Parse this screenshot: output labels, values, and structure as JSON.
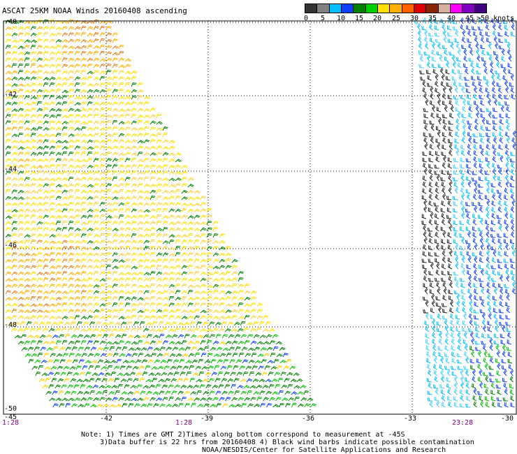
{
  "header": {
    "title": "ASCAT 25KM NOAA Winds 20160408 ascending"
  },
  "legend": {
    "swatches": [
      {
        "color": "#333333"
      },
      {
        "color": "#808080"
      },
      {
        "color": "#00bfff"
      },
      {
        "color": "#1040ff"
      },
      {
        "color": "#008000"
      },
      {
        "color": "#00d000"
      },
      {
        "color": "#ffe000"
      },
      {
        "color": "#ffb000"
      },
      {
        "color": "#ff6000"
      },
      {
        "color": "#e00000"
      },
      {
        "color": "#8b2500"
      },
      {
        "color": "#d8b0a0"
      },
      {
        "color": "#ff00ff"
      },
      {
        "color": "#8000c0"
      },
      {
        "color": "#400080"
      }
    ],
    "labels": [
      "0",
      "5",
      "10",
      "15",
      "20",
      "25",
      "30",
      "35",
      "40",
      "45",
      ">50 knots"
    ]
  },
  "map": {
    "lon_ticks": [
      "-45",
      "-42",
      "-39",
      "-36",
      "-33",
      "-30"
    ],
    "lat_ticks": [
      "-40",
      "-42",
      "-44",
      "-46",
      "-48",
      "-50"
    ],
    "times_bottom": [
      "1:28",
      "1:28",
      "23:28"
    ]
  },
  "notes": {
    "line1": "Note: 1) Times are GMT 2)Times along bottom correspond to measurement at -45S",
    "line2": "3)Data buffer is 22 hrs from 20160408 4) Black wind barbs indicate possible contamination",
    "line3": "NOAA/NESDIS/Center for Satellite Applications and Research"
  }
}
